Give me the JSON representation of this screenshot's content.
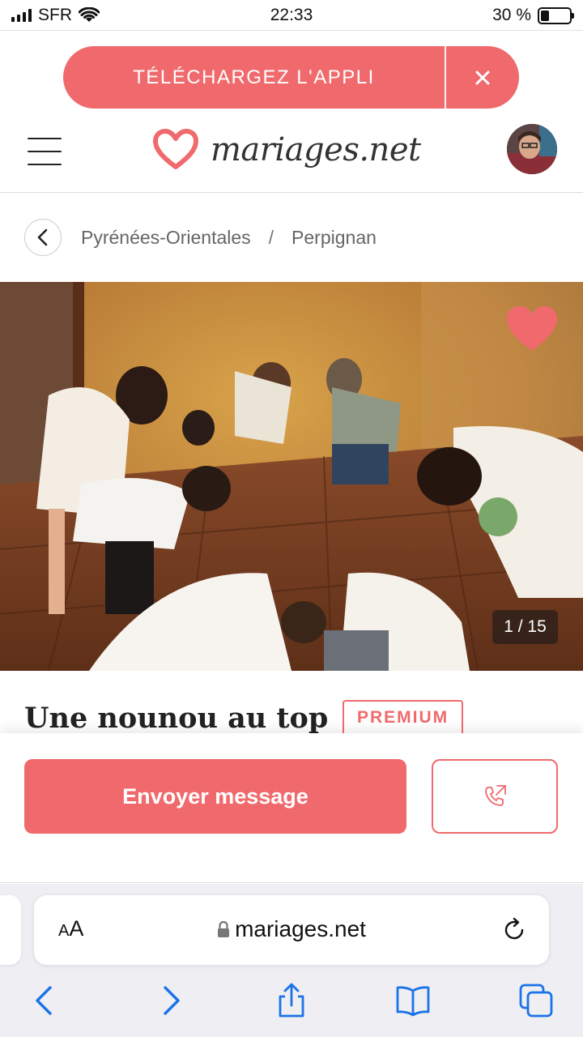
{
  "status_bar": {
    "carrier": "SFR",
    "time": "22:33",
    "battery": "30 %",
    "battery_level": 0.3
  },
  "app_banner": {
    "label": "TÉLÉCHARGEZ L'APPLI",
    "close": "×"
  },
  "header": {
    "logo_text": "mariages.net",
    "menu_icon": "hamburger-menu-icon",
    "avatar": "user-avatar"
  },
  "breadcrumb": {
    "items": [
      "Pyrénées-Orientales",
      "Perpignan"
    ],
    "separator": "/"
  },
  "gallery": {
    "counter": "1 / 15",
    "favorite_icon": "heart-icon"
  },
  "listing": {
    "title": "Une nounou au top",
    "badge": "PREMIUM"
  },
  "actions": {
    "send_label": "Envoyer message",
    "call_icon": "phone-call-icon"
  },
  "browser": {
    "text_size": "AA",
    "url": "mariages.net",
    "lock_icon": "lock-icon",
    "reload_icon": "reload-icon"
  },
  "colors": {
    "accent": "#f06a6d",
    "browser_blue": "#1a73e8"
  }
}
